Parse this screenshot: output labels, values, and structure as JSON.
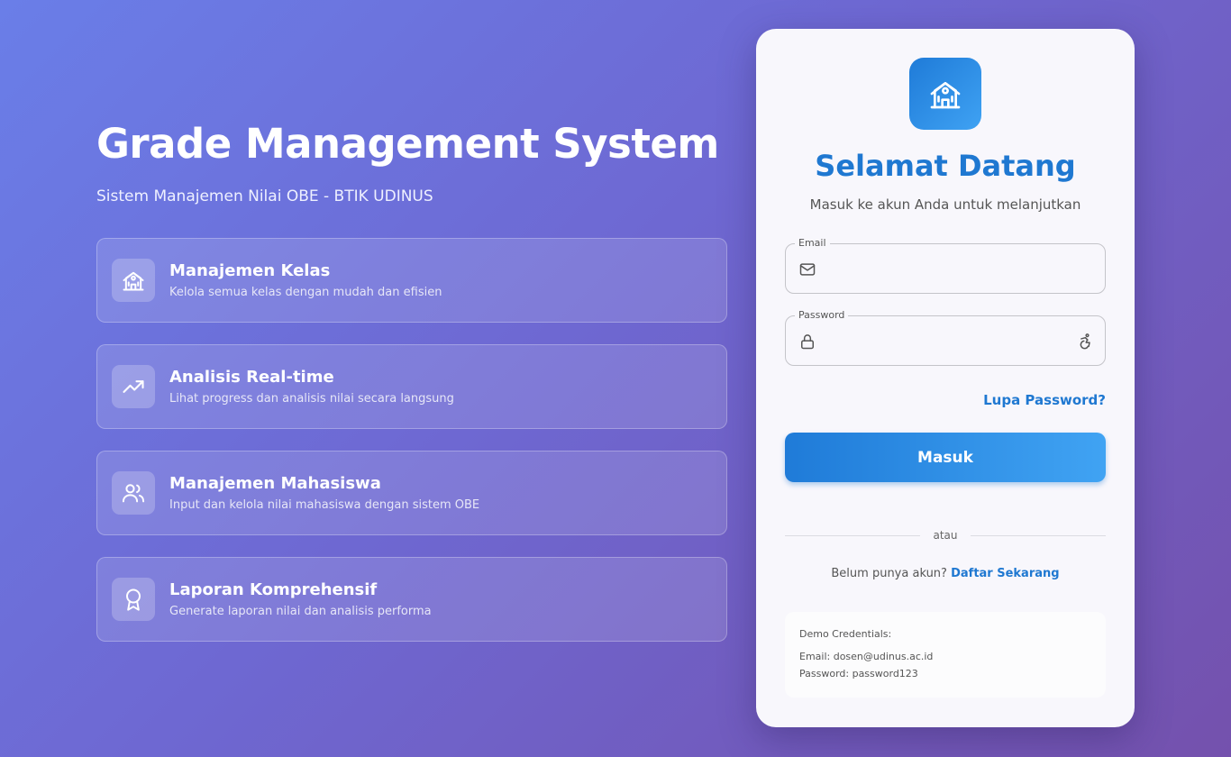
{
  "hero": {
    "title": "Grade Management System",
    "subtitle": "Sistem Manajemen Nilai OBE - BTIK UDINUS"
  },
  "features": [
    {
      "icon": "school-icon",
      "title": "Manajemen Kelas",
      "desc": "Kelola semua kelas dengan mudah dan efisien"
    },
    {
      "icon": "trending-up-icon",
      "title": "Analisis Real-time",
      "desc": "Lihat progress dan analisis nilai secara langsung"
    },
    {
      "icon": "users-icon",
      "title": "Manajemen Mahasiswa",
      "desc": "Input dan kelola nilai mahasiswa dengan sistem OBE"
    },
    {
      "icon": "award-icon",
      "title": "Laporan Komprehensif",
      "desc": "Generate laporan nilai dan analisis performa"
    }
  ],
  "login": {
    "logo_icon": "school-icon",
    "welcome": "Selamat Datang",
    "lead": "Masuk ke akun Anda untuk melanjutkan",
    "email": {
      "label": "Email",
      "value": "",
      "placeholder": "",
      "icon": "mail-icon"
    },
    "password": {
      "label": "Password",
      "value": "",
      "placeholder": "",
      "icon": "lock-icon",
      "toggle_icon": "accessibility-icon"
    },
    "forgot": "Lupa Password?",
    "submit": "Masuk",
    "divider": "atau",
    "signup_prompt": "Belum punya akun?",
    "signup_link": "Daftar Sekarang",
    "demo": {
      "heading": "Demo Credentials:",
      "email_line": "Email: dosen@udinus.ac.id",
      "password_line": "Password: password123"
    }
  },
  "colors": {
    "accent": "#1f78d1",
    "background_start": "#6a7ee8",
    "background_end": "#7451ad"
  }
}
